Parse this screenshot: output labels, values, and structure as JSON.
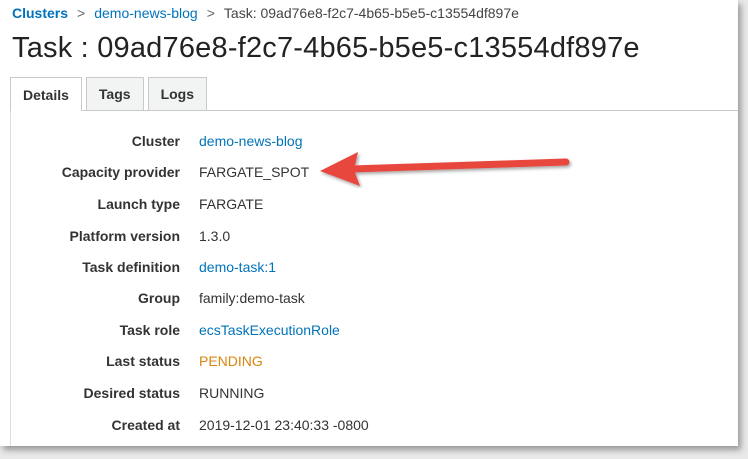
{
  "breadcrumb": {
    "clusters": "Clusters",
    "cluster": "demo-news-blog",
    "current": "Task: 09ad76e8-f2c7-4b65-b5e5-c13554df897e",
    "separator": ">"
  },
  "page_title": "Task : 09ad76e8-f2c7-4b65-b5e5-c13554df897e",
  "tabs": [
    {
      "label": "Details",
      "active": true
    },
    {
      "label": "Tags",
      "active": false
    },
    {
      "label": "Logs",
      "active": false
    }
  ],
  "details": [
    {
      "label": "Cluster",
      "value": "demo-news-blog",
      "style": "link"
    },
    {
      "label": "Capacity provider",
      "value": "FARGATE_SPOT",
      "style": "text"
    },
    {
      "label": "Launch type",
      "value": "FARGATE",
      "style": "text"
    },
    {
      "label": "Platform version",
      "value": "1.3.0",
      "style": "text"
    },
    {
      "label": "Task definition",
      "value": "demo-task:1",
      "style": "link"
    },
    {
      "label": "Group",
      "value": "family:demo-task",
      "style": "text"
    },
    {
      "label": "Task role",
      "value": "ecsTaskExecutionRole",
      "style": "link"
    },
    {
      "label": "Last status",
      "value": "PENDING",
      "style": "pending"
    },
    {
      "label": "Desired status",
      "value": "RUNNING",
      "style": "text"
    },
    {
      "label": "Created at",
      "value": "2019-12-01 23:40:33 -0800",
      "style": "text"
    }
  ],
  "colors": {
    "link": "#0073bb",
    "pending": "#d98410",
    "arrow": "#e8473c"
  },
  "annotation": {
    "icon": "red-arrow-icon",
    "points_to": "Capacity provider"
  }
}
